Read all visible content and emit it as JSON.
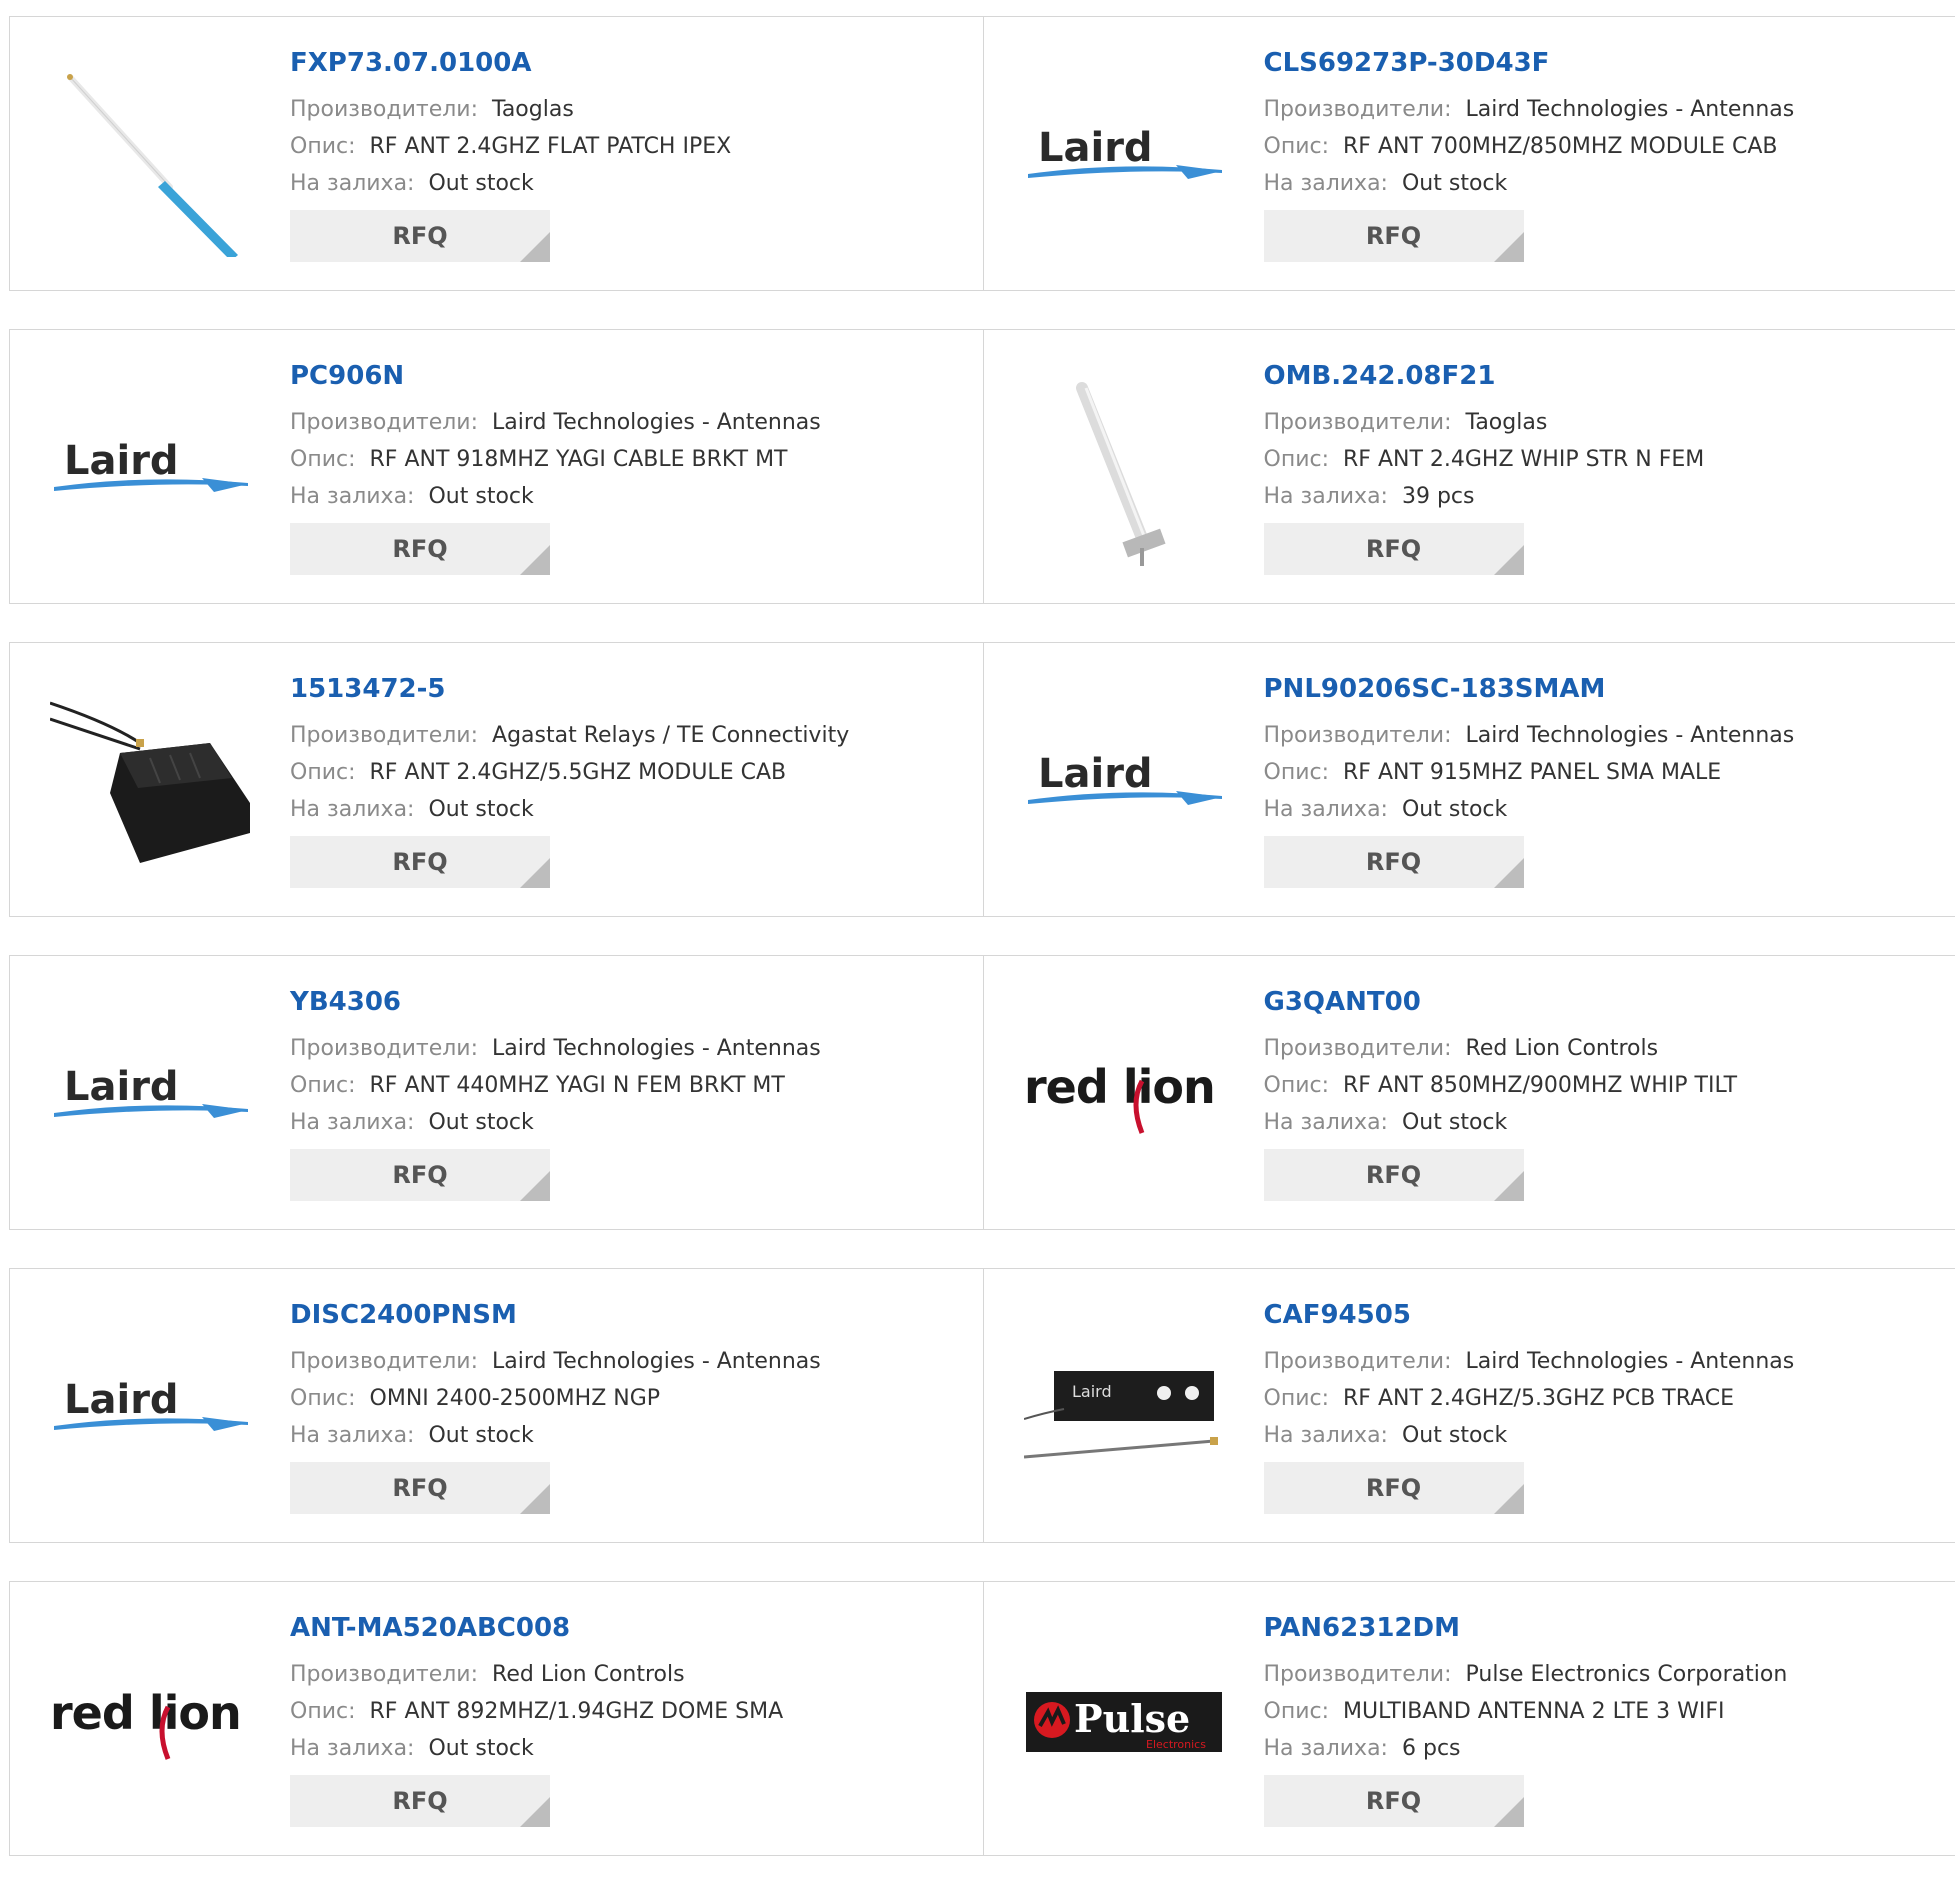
{
  "labels": {
    "manufacturer": "Производители:",
    "description": "Опис:",
    "stock": "На залиха:",
    "rfq": "RFQ"
  },
  "brand_colors": {
    "link": "#1a5fb0",
    "laird_text": "#2a2a2a",
    "laird_swoosh": "#3a8fd6",
    "redlion_accent": "#c8102e",
    "pulse_bg": "#1a1a1a",
    "pulse_red": "#d71920"
  },
  "products": [
    {
      "part": "FXP73.07.0100A",
      "manufacturer": "Taoglas",
      "description": "RF ANT 2.4GHZ FLAT PATCH IPEX",
      "stock": "Out stock",
      "image": "flat-patch-antenna"
    },
    {
      "part": "CLS69273P-30D43F",
      "manufacturer": "Laird Technologies - Antennas",
      "description": "RF ANT 700MHZ/850MHZ MODULE CAB",
      "stock": "Out stock",
      "image": "laird-logo",
      "logo_text": "Laird"
    },
    {
      "part": "PC906N",
      "manufacturer": "Laird Technologies - Antennas",
      "description": "RF ANT 918MHZ YAGI CABLE BRKT MT",
      "stock": "Out stock",
      "image": "laird-logo",
      "logo_text": "Laird"
    },
    {
      "part": "OMB.242.08F21",
      "manufacturer": "Taoglas",
      "description": "RF ANT 2.4GHZ WHIP STR N FEM",
      "stock": "39 pcs",
      "image": "whip-antenna"
    },
    {
      "part": "1513472-5",
      "manufacturer": "Agastat Relays / TE Connectivity",
      "description": "RF ANT 2.4GHZ/5.5GHZ MODULE CAB",
      "stock": "Out stock",
      "image": "module-antenna"
    },
    {
      "part": "PNL90206SC-183SMAM",
      "manufacturer": "Laird Technologies - Antennas",
      "description": "RF ANT 915MHZ PANEL SMA MALE",
      "stock": "Out stock",
      "image": "laird-logo",
      "logo_text": "Laird"
    },
    {
      "part": "YB4306",
      "manufacturer": "Laird Technologies - Antennas",
      "description": "RF ANT 440MHZ YAGI N FEM BRKT MT",
      "stock": "Out stock",
      "image": "laird-logo",
      "logo_text": "Laird"
    },
    {
      "part": "G3QANT00",
      "manufacturer": "Red Lion Controls",
      "description": "RF ANT 850MHZ/900MHZ WHIP TILT",
      "stock": "Out stock",
      "image": "redlion-logo",
      "logo_text": "red lion"
    },
    {
      "part": "DISC2400PNSM",
      "manufacturer": "Laird Technologies - Antennas",
      "description": "OMNI 2400-2500MHZ NGP",
      "stock": "Out stock",
      "image": "laird-logo",
      "logo_text": "Laird"
    },
    {
      "part": "CAF94505",
      "manufacturer": "Laird Technologies - Antennas",
      "description": "RF ANT 2.4GHZ/5.3GHZ PCB TRACE",
      "stock": "Out stock",
      "image": "pcb-antenna",
      "logo_text": "Laird"
    },
    {
      "part": "ANT-MA520ABC008",
      "manufacturer": "Red Lion Controls",
      "description": "RF ANT 892MHZ/1.94GHZ DOME SMA",
      "stock": "Out stock",
      "image": "redlion-logo",
      "logo_text": "red lion"
    },
    {
      "part": "PAN62312DM",
      "manufacturer": "Pulse Electronics Corporation",
      "description": "MULTIBAND ANTENNA 2 LTE 3 WIFI",
      "stock": "6 pcs",
      "image": "pulse-logo",
      "logo_text": "Pulse",
      "logo_subtext": "Electronics"
    }
  ]
}
